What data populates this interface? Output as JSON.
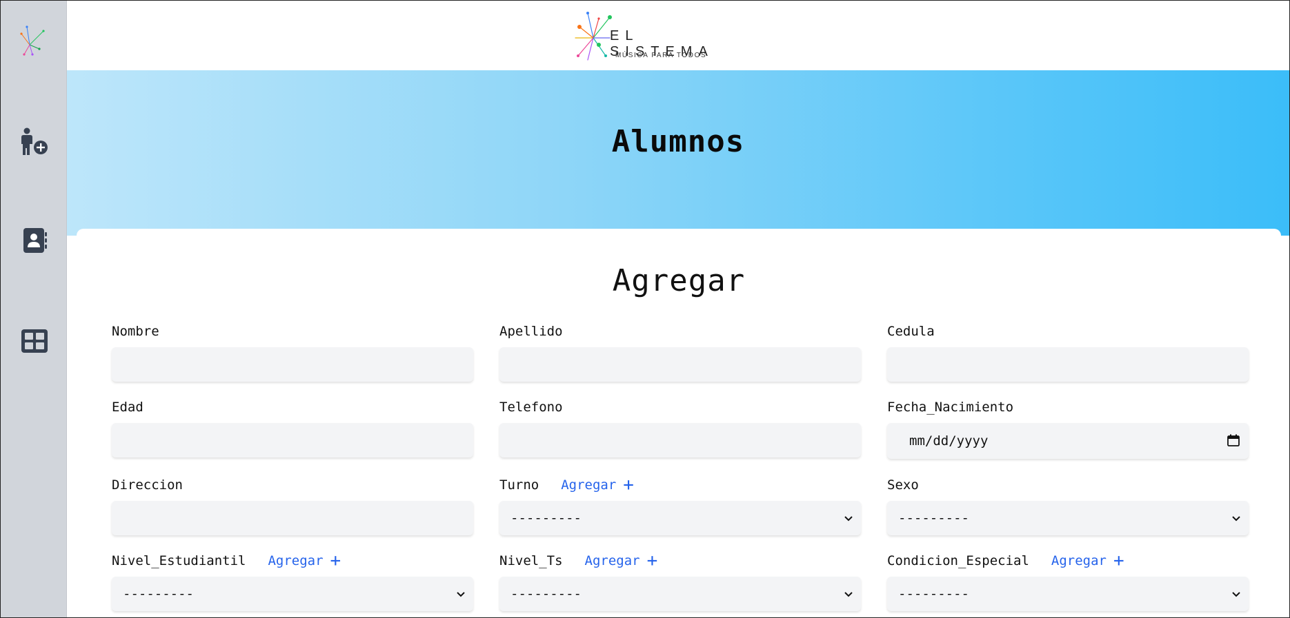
{
  "brand": {
    "name": "EL SISTEMA",
    "tagline": "MÚSICA PARA TODOS"
  },
  "sidebar": {
    "items": [
      {
        "icon": "person-add-icon"
      },
      {
        "icon": "contact-book-icon"
      },
      {
        "icon": "grid-table-icon"
      }
    ]
  },
  "hero": {
    "title": "Alumnos"
  },
  "form": {
    "title": "Agregar",
    "add_label": "Agregar",
    "fields": {
      "nombre": {
        "label": "Nombre",
        "value": ""
      },
      "apellido": {
        "label": "Apellido",
        "value": ""
      },
      "cedula": {
        "label": "Cedula",
        "value": ""
      },
      "edad": {
        "label": "Edad",
        "value": ""
      },
      "telefono": {
        "label": "Telefono",
        "value": ""
      },
      "fecha_nacimiento": {
        "label": "Fecha_Nacimiento",
        "value": "mm/dd/yyyy"
      },
      "direccion": {
        "label": "Direccion",
        "value": ""
      },
      "turno": {
        "label": "Turno",
        "selected": "---------"
      },
      "sexo": {
        "label": "Sexo",
        "selected": "---------"
      },
      "nivel_estudiantil": {
        "label": "Nivel_Estudiantil",
        "selected": "---------"
      },
      "nivel_ts": {
        "label": "Nivel_Ts",
        "selected": "---------"
      },
      "condicion_especial": {
        "label": "Condicion_Especial",
        "selected": "---------"
      }
    }
  },
  "colors": {
    "accent": "#2563eb",
    "sidebar": "#d1d5db",
    "hero_start": "#bde6fa",
    "hero_end": "#3bbdf9"
  }
}
